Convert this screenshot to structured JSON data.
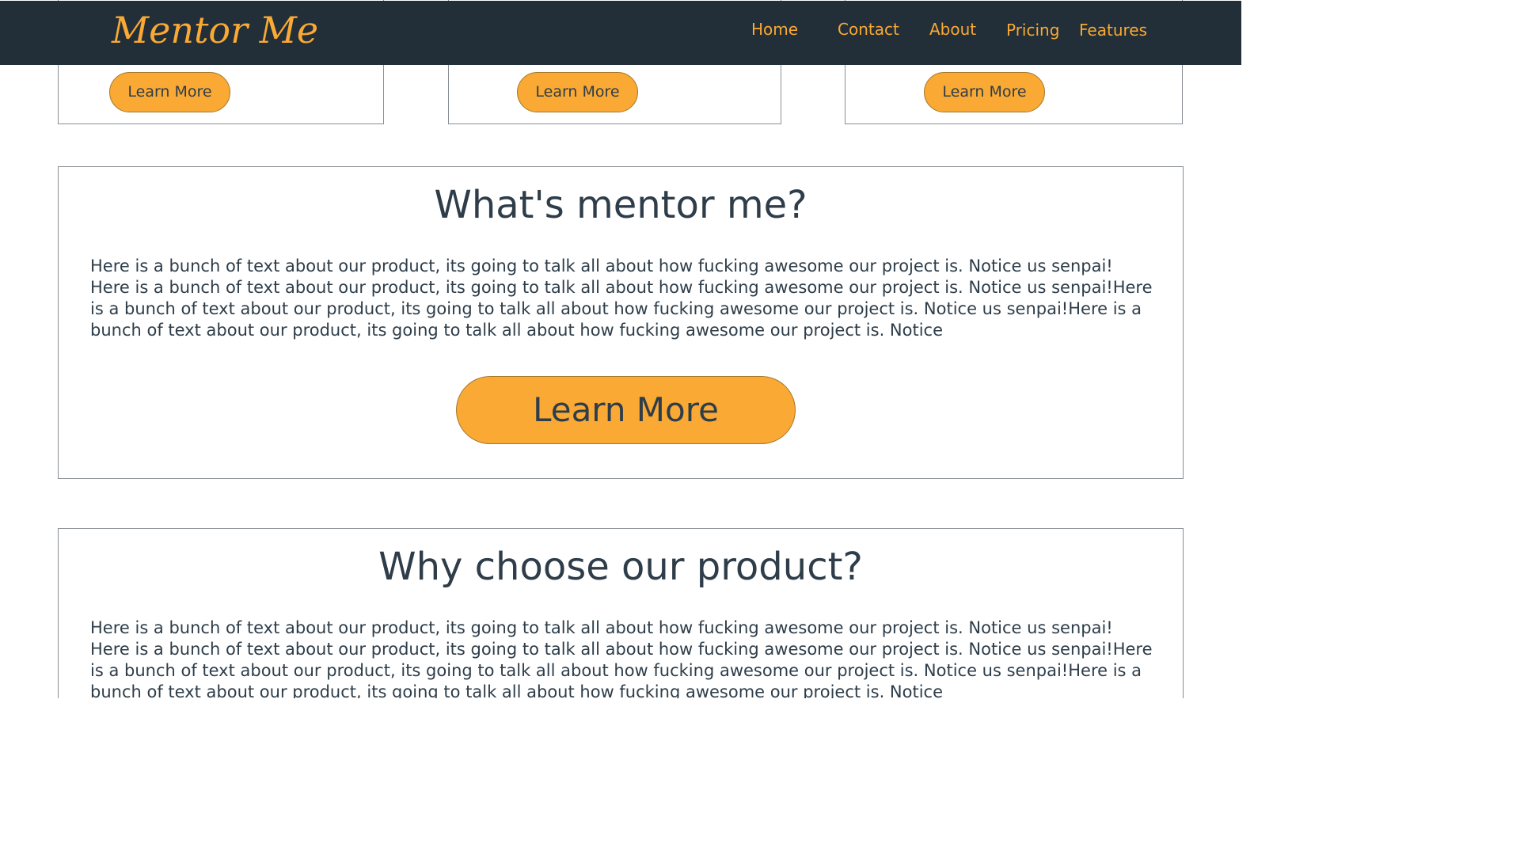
{
  "colors": {
    "navbar_bg": "#232f38",
    "accent": "#f9a934",
    "text": "#2e3d49",
    "border": "#8a8f94"
  },
  "navbar": {
    "logo": "Mentor Me",
    "links": [
      "Home",
      "Contact",
      "About",
      "Pricing",
      "Features"
    ]
  },
  "cards": [
    {
      "button_label": "Learn More"
    },
    {
      "button_label": "Learn More"
    },
    {
      "button_label": "Learn More"
    }
  ],
  "sections": [
    {
      "title": "What's mentor me?",
      "text": "Here is a bunch of text about our product, its going to talk all about how fucking awesome our project is. Notice us senpai! Here is a bunch of text about our product, its going to talk all about how fucking awesome our project is. Notice us senpai!Here is a bunch of text about our product, its going to talk all about how fucking awesome our project is. Notice us senpai!Here is a bunch of text about our product, its going to talk all about how fucking awesome our project is. Notice",
      "button_label": "Learn More"
    },
    {
      "title": "Why choose our product?",
      "text": "Here is a bunch of text about our product, its going to talk all about how fucking awesome our project is. Notice us senpai! Here is a bunch of text about our product, its going to talk all about how fucking awesome our project is. Notice us senpai!Here is a bunch of text about our product, its going to talk all about how fucking awesome our project is. Notice us senpai!Here is a bunch of text about our product, its going to talk all about how fucking awesome our project is. Notice"
    }
  ]
}
